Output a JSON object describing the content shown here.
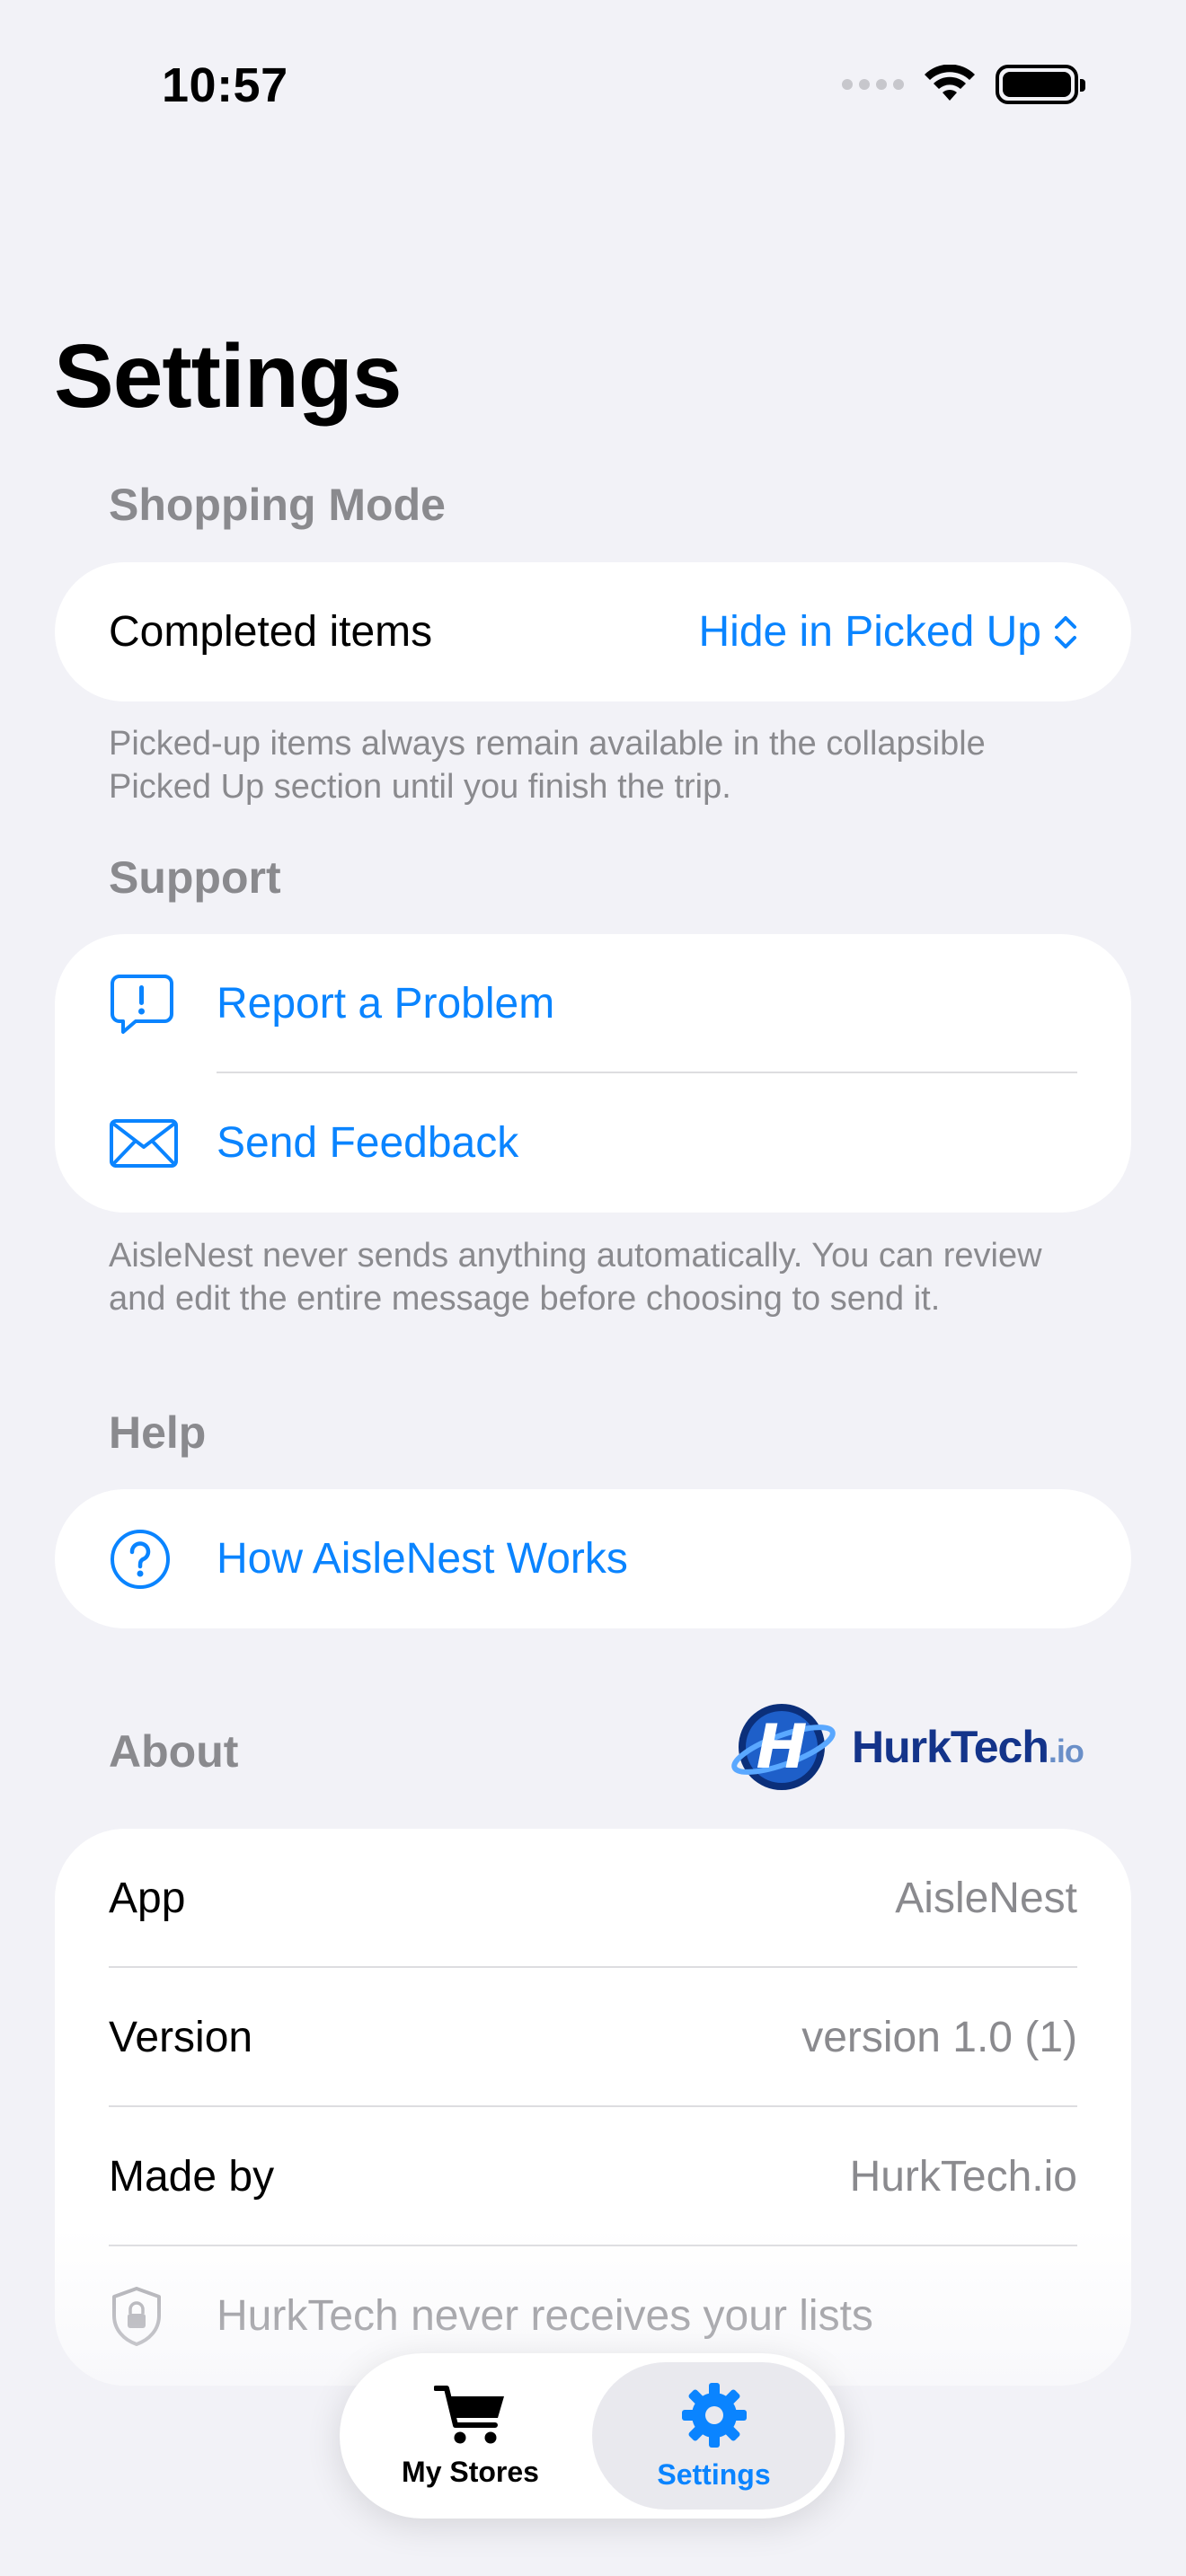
{
  "status": {
    "time": "10:57"
  },
  "page": {
    "title": "Settings"
  },
  "shopping_mode": {
    "header": "Shopping Mode",
    "completed_items_label": "Completed items",
    "completed_items_value": "Hide in Picked Up",
    "footer": "Picked-up items always remain available in the collapsible Picked Up section until you finish the trip."
  },
  "support": {
    "header": "Support",
    "items": [
      {
        "label": "Report a Problem",
        "icon": "report-bubble-icon"
      },
      {
        "label": "Send Feedback",
        "icon": "envelope-icon"
      }
    ],
    "footer": "AisleNest never sends anything automatically. You can review and edit the entire message before choosing to send it."
  },
  "help": {
    "header": "Help",
    "items": [
      {
        "label": "How AisleNest Works",
        "icon": "question-circle-icon"
      }
    ]
  },
  "about": {
    "header": "About",
    "logo_text": "HurkTech",
    "logo_suffix": ".io",
    "rows": [
      {
        "label": "App",
        "value": "AisleNest"
      },
      {
        "label": "Version",
        "value": "version 1.0 (1)"
      },
      {
        "label": "Made by",
        "value": "HurkTech.io"
      }
    ],
    "privacy_note": "HurkTech never receives your lists"
  },
  "tabs": [
    {
      "label": "My Stores",
      "icon": "cart-icon",
      "active": false
    },
    {
      "label": "Settings",
      "icon": "gear-icon",
      "active": true
    }
  ],
  "colors": {
    "accent": "#0A84FF",
    "background": "#F2F2F7",
    "secondary_text": "#8A8A8E"
  }
}
